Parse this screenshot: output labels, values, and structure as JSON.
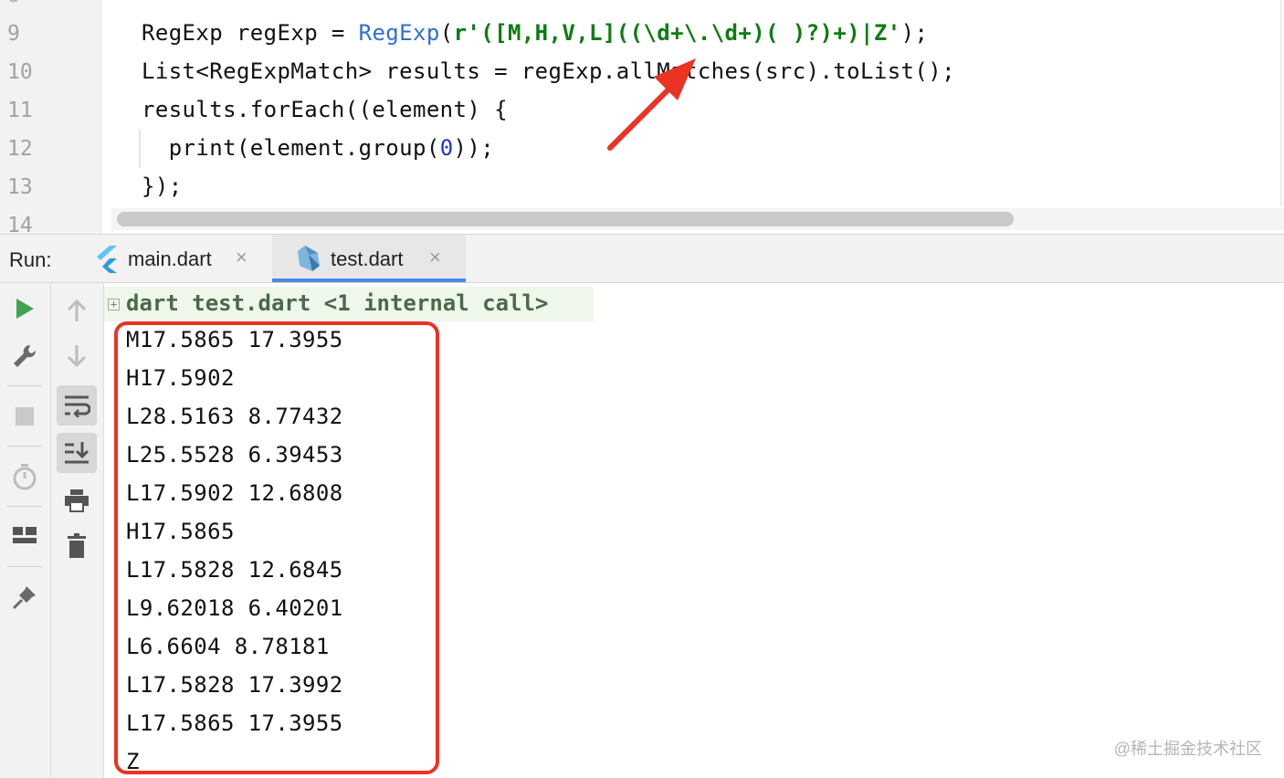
{
  "editor": {
    "line_numbers": [
      "9",
      "10",
      "11",
      "12",
      "13",
      "14"
    ],
    "lines": {
      "l9_a": "RegExp regExp = ",
      "l9_type": "RegExp",
      "l9_b": "(",
      "l9_str": "r'([M,H,V,L]((\\d+\\.\\d+)( )?)+)|Z'",
      "l9_c": ");",
      "l10": "List<RegExpMatch> results = regExp.allMatches(src).toList();",
      "l11": "results.forEach((element) {",
      "l12_a": "  print(element.group(",
      "l12_num": "0",
      "l12_b": "));",
      "l13": "});"
    }
  },
  "run_panel": {
    "label": "Run:",
    "tabs": [
      {
        "label": "main.dart",
        "close": "×",
        "icon": "flutter-icon"
      },
      {
        "label": "test.dart",
        "close": "×",
        "icon": "dart-icon"
      }
    ]
  },
  "console": {
    "header": "dart test.dart <1 internal call>",
    "fold_symbol": "+",
    "output": [
      "M17.5865 17.3955",
      "H17.5902",
      "L28.5163 8.77432",
      "L25.5528 6.39453",
      "L17.5902 12.6808",
      "H17.5865",
      "L17.5828 12.6845",
      "L9.62018 6.40201",
      "L6.6604 8.78181",
      "L17.5828 17.3992",
      "L17.5865 17.3955",
      "Z"
    ]
  },
  "toolbar_icons": [
    "run-icon",
    "wrench-icon",
    "stop-icon",
    "timer-icon",
    "layout-icon",
    "pin-icon",
    "up-arrow-icon",
    "down-arrow-icon",
    "soft-wrap-icon",
    "scroll-to-end-icon",
    "print-icon",
    "trash-icon"
  ],
  "annotation": {
    "arrow_color": "#ea3323",
    "box_color": "#ea3323"
  },
  "watermark": "@稀土掘金技术社区"
}
